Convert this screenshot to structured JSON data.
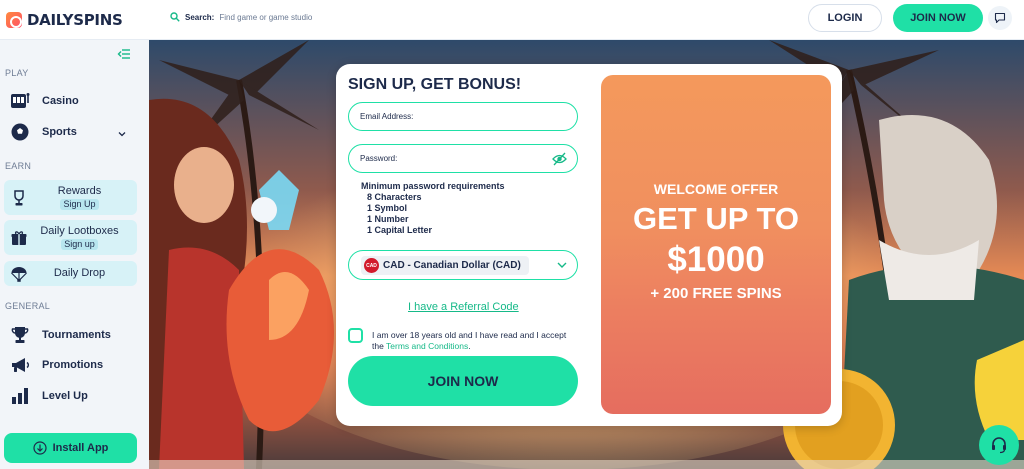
{
  "brand": {
    "name": "DAILYSPINS"
  },
  "search": {
    "label": "Search:",
    "placeholder": "Find game or game studio"
  },
  "header": {
    "login_label": "LOGIN",
    "join_label": "JOIN NOW"
  },
  "sidebar": {
    "sections": {
      "play": "PLAY",
      "earn": "EARN",
      "general": "GENERAL"
    },
    "play_items": [
      {
        "label": "Casino",
        "icon": "slot-machine-icon"
      },
      {
        "label": "Sports",
        "icon": "soccer-ball-icon"
      }
    ],
    "earn_items": [
      {
        "label": "Rewards",
        "badge": "Sign Up",
        "icon": "trophy-icon"
      },
      {
        "label": "Daily Lootboxes",
        "badge": "Sign up",
        "icon": "gift-box-icon"
      },
      {
        "label": "Daily Drop",
        "badge": "",
        "icon": "parachute-icon"
      }
    ],
    "general_items": [
      {
        "label": "Tournaments",
        "icon": "trophy-icon"
      },
      {
        "label": "Promotions",
        "icon": "megaphone-icon"
      },
      {
        "label": "Level Up",
        "icon": "bar-chart-icon"
      }
    ],
    "install_label": "Install App"
  },
  "signup": {
    "title": "SIGN UP, GET BONUS!",
    "email_label": "Email Address:",
    "password_label": "Password:",
    "requirements_title": "Minimum password requirements",
    "requirements": [
      "8 Characters",
      "1 Symbol",
      "1 Number",
      "1 Capital Letter"
    ],
    "currency_code": "CAD",
    "currency_label": "CAD - Canadian Dollar (CAD)",
    "referral_label": "I have a Referral Code",
    "terms_prefix": "I am over 18 years old and I have read and I accept the",
    "terms_link": "Terms and Conditions",
    "terms_suffix": ".",
    "submit_label": "JOIN NOW"
  },
  "promo": {
    "line1": "WELCOME OFFER",
    "line2": "GET UP TO",
    "line3": "$1000",
    "line4": "+ 200 FREE SPINS"
  },
  "colors": {
    "accent": "#1fe0a6",
    "brand_text": "#1d2a4a",
    "promo": "#f08f5f"
  }
}
